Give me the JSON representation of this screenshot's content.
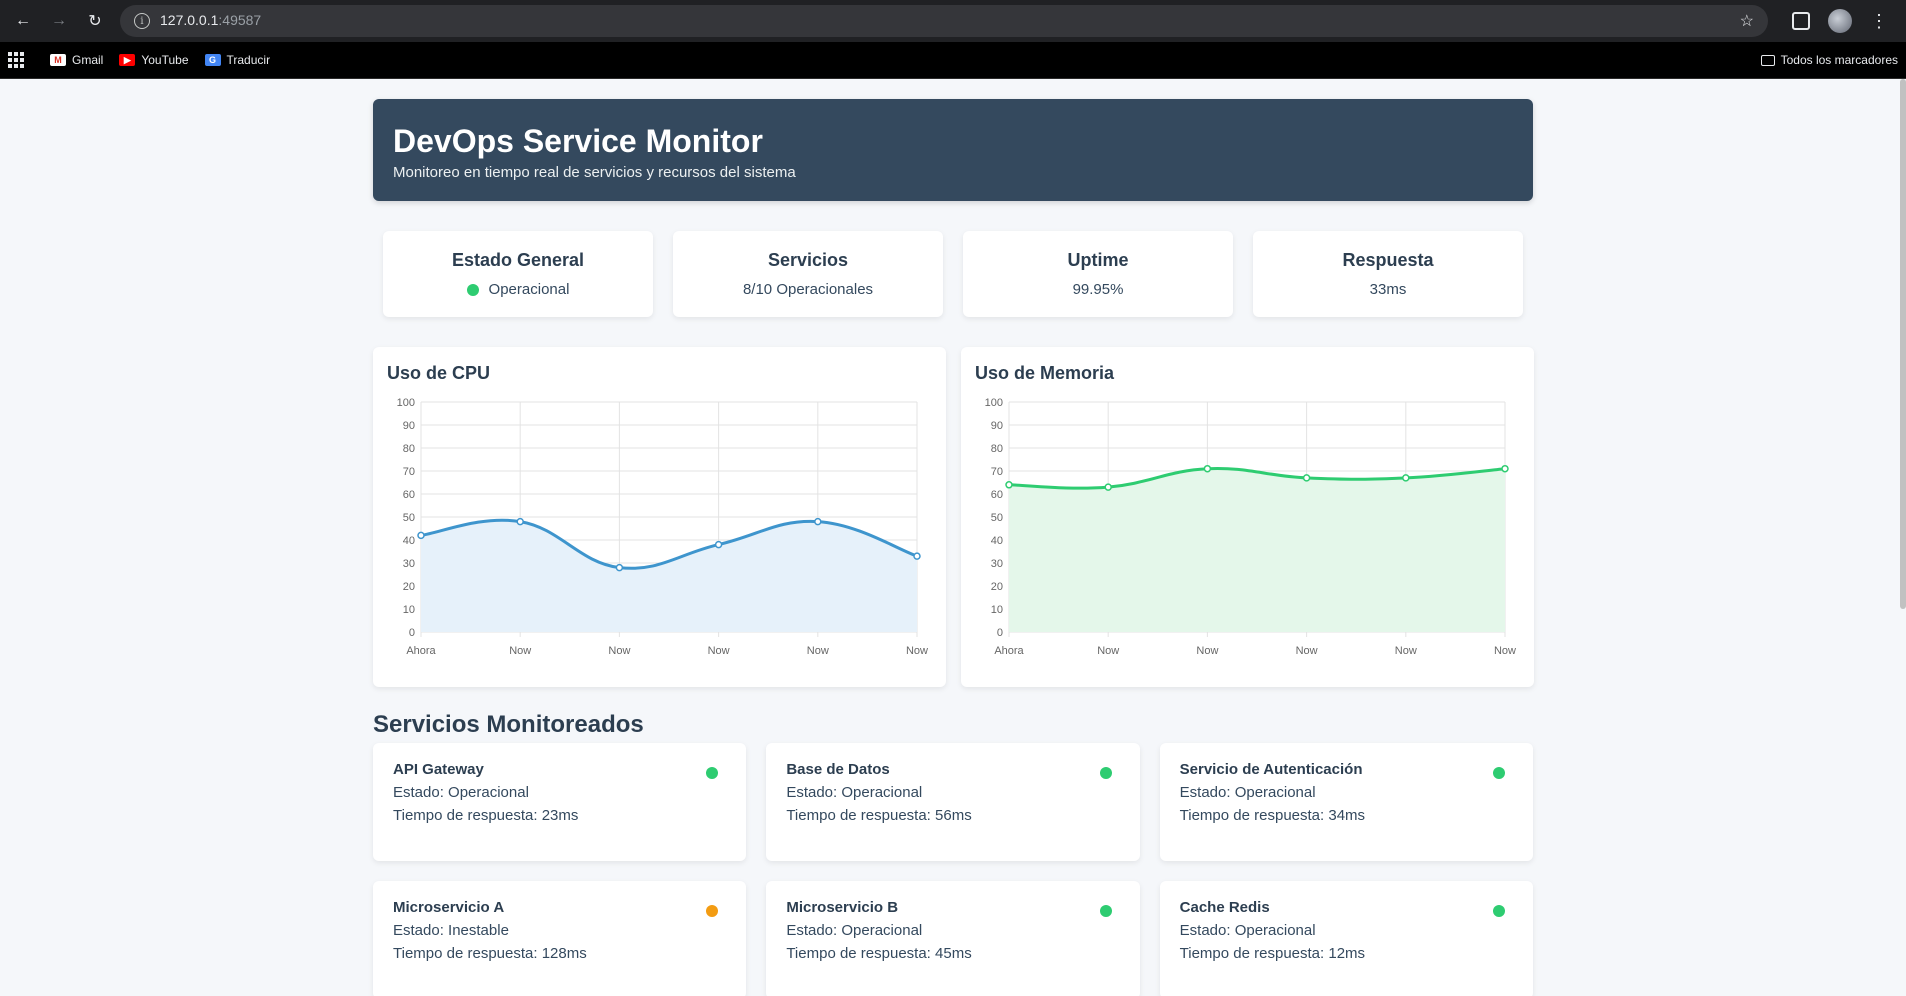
{
  "browser": {
    "url_host": "127.0.0.1",
    "url_port": ":49587",
    "bookmarks": [
      {
        "label": "Gmail",
        "icon": "gmail-icon"
      },
      {
        "label": "YouTube",
        "icon": "youtube-icon"
      },
      {
        "label": "Traducir",
        "icon": "translate-icon"
      }
    ],
    "all_bookmarks": "Todos los marcadores"
  },
  "header": {
    "title": "DevOps Service Monitor",
    "subtitle": "Monitoreo en tiempo real de servicios y recursos del sistema"
  },
  "stats": [
    {
      "title": "Estado General",
      "value": "Operacional",
      "dot_color": "#2ecc71"
    },
    {
      "title": "Servicios",
      "value": "8/10 Operacionales"
    },
    {
      "title": "Uptime",
      "value": "99.95%"
    },
    {
      "title": "Respuesta",
      "value": "33ms"
    }
  ],
  "charts": {
    "cpu_title": "Uso de CPU",
    "memory_title": "Uso de Memoria"
  },
  "chart_data": [
    {
      "type": "area",
      "title": "Uso de CPU",
      "categories": [
        "Ahora",
        "Now",
        "Now",
        "Now",
        "Now",
        "Now"
      ],
      "values": [
        42,
        48,
        28,
        38,
        48,
        33
      ],
      "ylim": [
        0,
        100
      ],
      "yticks": [
        "0",
        "10",
        "20",
        "30",
        "40",
        "50",
        "60",
        "70",
        "80",
        "90",
        "100"
      ],
      "color": "#3e95cd",
      "fill": "#e6f1fa",
      "grid": true
    },
    {
      "type": "area",
      "title": "Uso de Memoria",
      "categories": [
        "Ahora",
        "Now",
        "Now",
        "Now",
        "Now",
        "Now"
      ],
      "values": [
        64,
        63,
        71,
        67,
        67,
        71
      ],
      "ylim": [
        0,
        100
      ],
      "yticks": [
        "0",
        "10",
        "20",
        "30",
        "40",
        "50",
        "60",
        "70",
        "80",
        "90",
        "100"
      ],
      "color": "#2ecc71",
      "fill": "#e4f7ea",
      "grid": true
    }
  ],
  "services_title": "Servicios Monitoreados",
  "services": [
    {
      "name": "API Gateway",
      "status": "Estado: Operacional",
      "response": "Tiempo de respuesta: 23ms",
      "color": "#2ecc71"
    },
    {
      "name": "Base de Datos",
      "status": "Estado: Operacional",
      "response": "Tiempo de respuesta: 56ms",
      "color": "#2ecc71"
    },
    {
      "name": "Servicio de Autenticación",
      "status": "Estado: Operacional",
      "response": "Tiempo de respuesta: 34ms",
      "color": "#2ecc71"
    },
    {
      "name": "Microservicio A",
      "status": "Estado: Inestable",
      "response": "Tiempo de respuesta: 128ms",
      "color": "#f39c12"
    },
    {
      "name": "Microservicio B",
      "status": "Estado: Operacional",
      "response": "Tiempo de respuesta: 45ms",
      "color": "#2ecc71"
    },
    {
      "name": "Cache Redis",
      "status": "Estado: Operacional",
      "response": "Tiempo de respuesta: 12ms",
      "color": "#2ecc71"
    }
  ]
}
